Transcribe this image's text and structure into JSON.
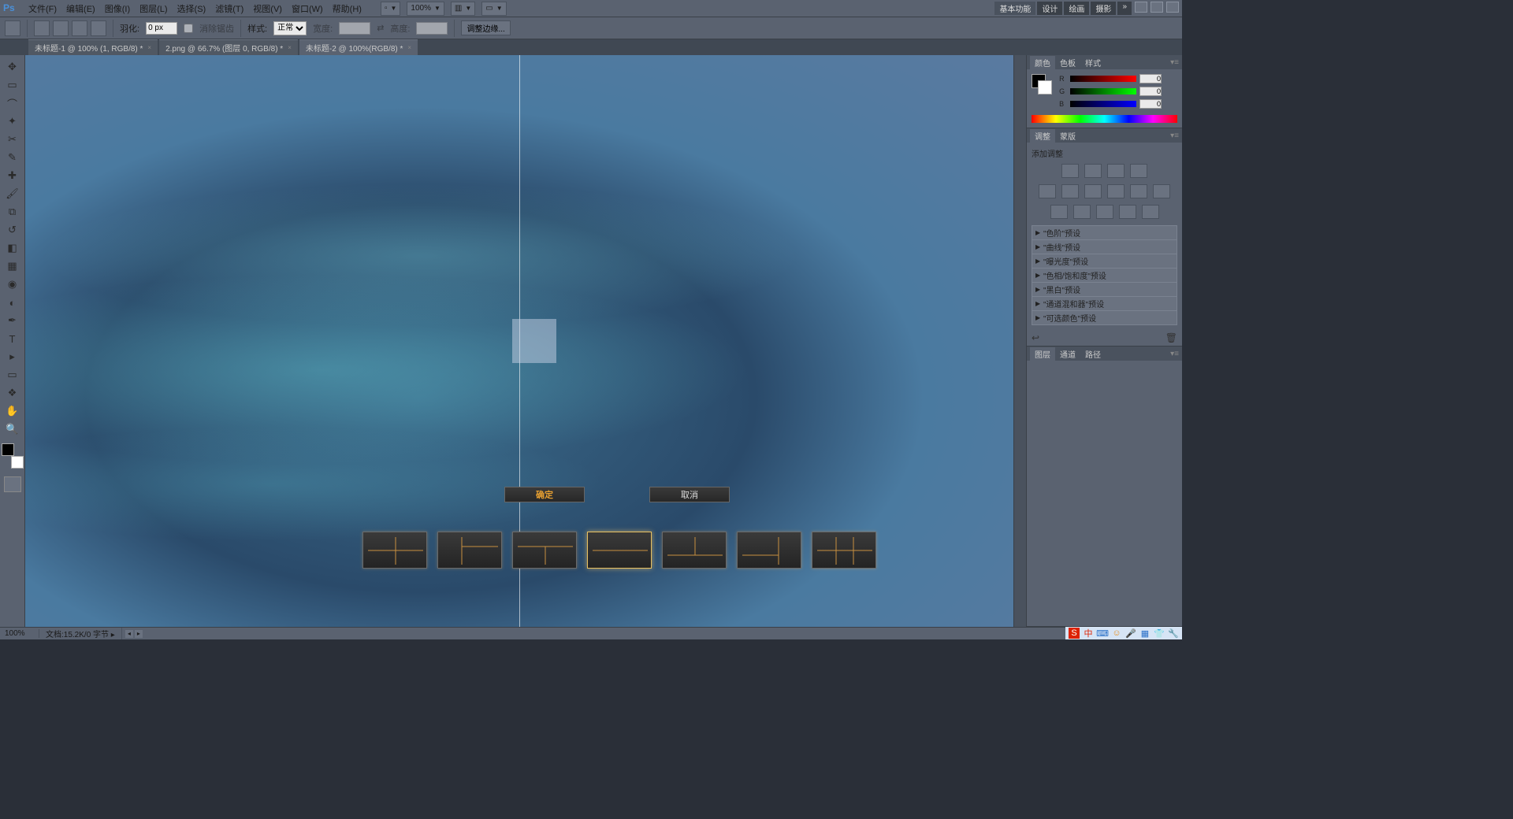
{
  "menu": {
    "items": [
      "文件(F)",
      "编辑(E)",
      "图像(I)",
      "图层(L)",
      "选择(S)",
      "滤镜(T)",
      "视图(V)",
      "窗口(W)",
      "帮助(H)"
    ],
    "zoom": "100%",
    "workspaces": [
      "基本功能",
      "设计",
      "绘画",
      "摄影"
    ],
    "collapse": "»"
  },
  "options": {
    "feather_label": "羽化:",
    "feather_val": "0 px",
    "antialias": "消除锯齿",
    "style_label": "样式:",
    "style_val": "正常",
    "width_label": "宽度:",
    "height_label": "高度:",
    "refine": "调整边缘..."
  },
  "tabs": [
    "未标题-1 @ 100% (1, RGB/8) *",
    "2.png @ 66.7% (图层 0, RGB/8) *",
    "未标题-2 @ 100%(RGB/8) *"
  ],
  "dialog": {
    "ok": "确定",
    "cancel": "取消"
  },
  "panels": {
    "color": {
      "tabs": [
        "颜色",
        "色板",
        "样式"
      ],
      "r": "0",
      "g": "0",
      "b": "0"
    },
    "adjustments": {
      "tabs": [
        "调整",
        "蒙版"
      ],
      "title": "添加调整",
      "presets": [
        "\"色阶\"预设",
        "\"曲线\"预设",
        "\"曝光度\"预设",
        "\"色相/饱和度\"预设",
        "\"黑白\"预设",
        "\"通道混和器\"预设",
        "\"可选颜色\"预设"
      ]
    },
    "layers": {
      "tabs": [
        "图层",
        "通道",
        "路径"
      ]
    }
  },
  "status": {
    "zoom": "100%",
    "doc": "文档:15.2K/0 字节"
  },
  "tray": {
    "ime": "中"
  }
}
